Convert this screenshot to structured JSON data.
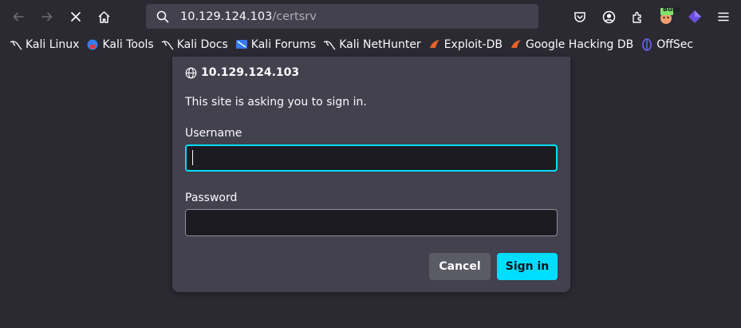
{
  "browser": {
    "url_host": "10.129.124.103",
    "url_path": "/certsrv",
    "toolbar_icons": [
      "back-arrow-icon",
      "forward-arrow-icon",
      "stop-icon",
      "home-icon",
      "search-icon",
      "pocket-icon",
      "account-icon",
      "extensions-icon",
      "burp-extension-icon",
      "foxyproxy-icon",
      "menu-icon"
    ],
    "burp_badge": "Burp"
  },
  "bookmarks": [
    {
      "label": "Kali Linux",
      "icon": "kali-dragon-icon"
    },
    {
      "label": "Kali Tools",
      "icon": "kali-tools-icon"
    },
    {
      "label": "Kali Docs",
      "icon": "kali-dragon-icon"
    },
    {
      "label": "Kali Forums",
      "icon": "kali-forums-icon"
    },
    {
      "label": "Kali NetHunter",
      "icon": "kali-dragon-icon"
    },
    {
      "label": "Exploit-DB",
      "icon": "exploit-db-icon"
    },
    {
      "label": "Google Hacking DB",
      "icon": "exploit-db-icon"
    },
    {
      "label": "OffSec",
      "icon": "offsec-icon"
    }
  ],
  "dialog": {
    "host": "10.129.124.103",
    "message": "This site is asking you to sign in.",
    "username_label": "Username",
    "username_value": "",
    "password_label": "Password",
    "password_value": "",
    "cancel_label": "Cancel",
    "signin_label": "Sign in"
  },
  "colors": {
    "accent": "#00ddff",
    "background": "#2b2a33",
    "dialog": "#42414d",
    "input": "#1c1b22"
  }
}
